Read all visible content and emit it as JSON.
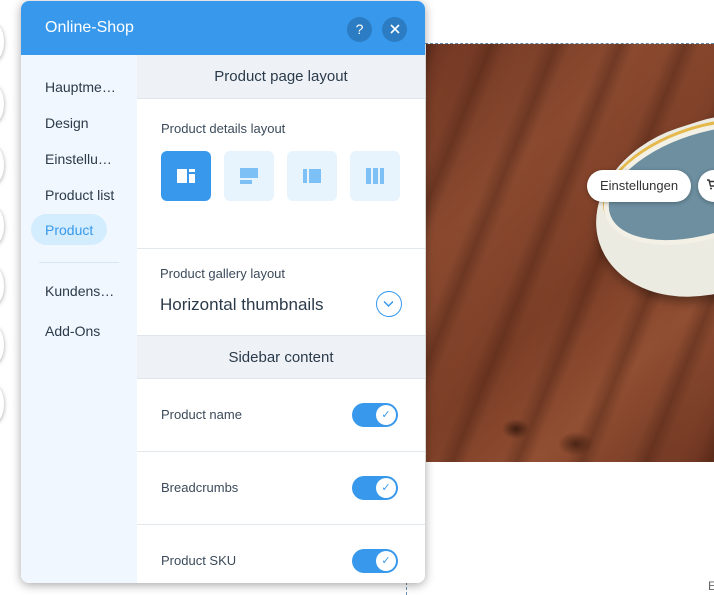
{
  "panel": {
    "title": "Online-Shop",
    "help_icon": "question-icon",
    "close_icon": "close-icon",
    "accent": "#3899ec"
  },
  "sidebar": {
    "items": [
      {
        "label": "Hauptmenü"
      },
      {
        "label": "Design"
      },
      {
        "label": "Einstellungen"
      },
      {
        "label": "Product list"
      },
      {
        "label": "Product",
        "active": true
      },
      {
        "label": "Kundenservice"
      },
      {
        "label": "Add-Ons"
      }
    ]
  },
  "content": {
    "layout_section": "Product page layout",
    "details_label": "Product details layout",
    "layout_options": [
      {
        "icon": "layout-left-image-icon",
        "selected": true
      },
      {
        "icon": "layout-top-image-icon",
        "selected": false
      },
      {
        "icon": "layout-center-image-icon",
        "selected": false
      },
      {
        "icon": "layout-columns-icon",
        "selected": false
      }
    ],
    "gallery_label": "Product gallery layout",
    "gallery_value": "Horizontal thumbnails",
    "sidebar_section": "Sidebar content",
    "toggles": [
      {
        "label": "Product name",
        "on": true
      },
      {
        "label": "Breadcrumbs",
        "on": true
      },
      {
        "label": "Product SKU",
        "on": true
      }
    ]
  },
  "canvas": {
    "einstellungen_button": "Einstellungen",
    "corner_letter": "E"
  }
}
